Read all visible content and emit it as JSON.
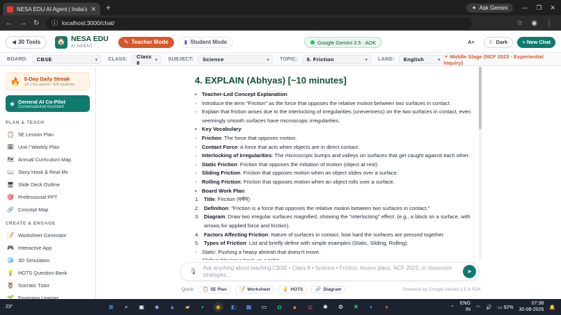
{
  "browser": {
    "tab_title": "NESA EDU AI Agent | India's Sm",
    "new_tab": "+",
    "url": "localhost:3000/chat/",
    "ask_gemini": "Ask Gemini",
    "window_controls": [
      "—",
      "❐",
      "✕"
    ]
  },
  "header": {
    "tools_label": "30 Tools",
    "brand_name": "NESA EDU",
    "brand_sub": "AI AGENT",
    "teacher_mode": "Teacher Mode",
    "student_mode": "Student Mode",
    "model_label": "Google Gemini 3.5 · ADK",
    "font_btn": "A+",
    "theme_btn": "Dark",
    "new_chat": "+ New Chat"
  },
  "filters": {
    "board_label": "BOARD:",
    "board_value": "CBSE",
    "class_label": "CLASS:",
    "class_value": "Class 8",
    "subject_label": "SUBJECT:",
    "subject_value": "Science",
    "topic_label": "TOPIC:",
    "topic_value": "9. Friction",
    "lang_label": "LANG:",
    "lang_value": "English",
    "stage": "Middle Stage (NCF 2023 · Experiential Inquiry)"
  },
  "sidebar": {
    "streak_title": "5-Day Daily Streak",
    "streak_sub": "14.2 hrs saved • 420 students",
    "copilot_title": "General AI Co-Pilot",
    "copilot_sub": "Conversational Assistant",
    "section1": "PLAN & TEACH",
    "plan_items": [
      {
        "label": "5E Lesson Plan",
        "icon": "📋"
      },
      {
        "label": "Unit / Weekly Plan",
        "icon": "🗓"
      },
      {
        "label": "Annual Curriculum Map",
        "icon": "🗺"
      },
      {
        "label": "Story Hook & Real-life",
        "icon": "📖"
      },
      {
        "label": "Slide Deck Outline",
        "icon": "🖥"
      },
      {
        "label": "Professional PPT",
        "icon": "🎯"
      },
      {
        "label": "Concept Map",
        "icon": "🔗"
      }
    ],
    "section2": "CREATE & ENGAGE",
    "create_items": [
      {
        "label": "Worksheet Generator",
        "icon": "📝"
      },
      {
        "label": "Interactive App",
        "icon": "🎮"
      },
      {
        "label": "3D Simulation",
        "icon": "🧊"
      },
      {
        "label": "HOTS Question Bank",
        "icon": "💡"
      },
      {
        "label": "Socratic Tutor",
        "icon": "🦉"
      },
      {
        "label": "Emerging Learner",
        "icon": "🌱"
      }
    ]
  },
  "lesson": {
    "heading": "4. EXPLAIN (Abhyas) [~10 minutes]",
    "lines": [
      {
        "bullet": "•",
        "bold": "Teacher-Led Concept Explanation",
        "text": ":",
        "italic": ""
      },
      {
        "bullet": "◦",
        "bold": "",
        "text": "Introduce the term \"Friction\" as the force that opposes the relative motion between two surfaces in contact.",
        "italic": ""
      },
      {
        "bullet": "◦",
        "bold": "",
        "text": "Explain that friction arises due to the interlocking of irregularities (unevenness) on the two surfaces in contact, even seemingly smooth surfaces have microscopic irregularities.",
        "italic": ""
      },
      {
        "bullet": "•",
        "bold": "Key Vocabulary",
        "text": ":",
        "italic": ""
      },
      {
        "bullet": "◦",
        "bold": "Friction",
        "text": ": The force that opposes motion.",
        "italic": ""
      },
      {
        "bullet": "◦",
        "bold": "Contact Force",
        "text": ": A force that acts when objects are in direct contact.",
        "italic": ""
      },
      {
        "bullet": "◦",
        "bold": "Interlocking of Irregularities",
        "text": ": The microscopic bumps and valleys on surfaces that get caught against each other.",
        "italic": ""
      },
      {
        "bullet": "◦",
        "bold": "Static Friction",
        "text": ": Friction that opposes the initiation of motion (object at rest).",
        "italic": ""
      },
      {
        "bullet": "◦",
        "bold": "Sliding Friction",
        "text": ": Friction that opposes motion when an object slides over a surface.",
        "italic": ""
      },
      {
        "bullet": "◦",
        "bold": "Rolling Friction",
        "text": ": Friction that opposes motion when an object rolls over a surface.",
        "italic": ""
      },
      {
        "bullet": "•",
        "bold": "Board Work Plan",
        "text": ":",
        "italic": ""
      },
      {
        "bullet": "1.",
        "bold": "Title",
        "text": ": Friction (घर्षण)",
        "italic": ""
      },
      {
        "bullet": "2.",
        "bold": "Definition",
        "text": ": \"Friction is a force that opposes the relative motion between two surfaces in contact.\"",
        "italic": ""
      },
      {
        "bullet": "3.",
        "bold": "Diagram",
        "text": ": Draw two irregular surfaces magnified, showing the \"interlocking\" effect. (e.g., a block on a surface, with arrows for applied force and friction).",
        "italic": ""
      },
      {
        "bullet": "4.",
        "bold": "Factors Affecting Friction",
        "text": ": Nature of surfaces in contact, how hard the surfaces are pressed together.",
        "italic": ""
      },
      {
        "bullet": "5.",
        "bold": "Types of Friction",
        "text": ": List and briefly define with simple examples (Static, Sliding, Rolling).",
        "italic": ""
      },
      {
        "bullet": "◦",
        "bold": "",
        "text": ": Pushing a heavy almirah that doesn't move.",
        "italic": "Static"
      },
      {
        "bullet": "◦",
        "bold": "",
        "text": ": Moving a book on a table.",
        "italic": "Sliding"
      }
    ]
  },
  "composer": {
    "placeholder": "Ask anything about teaching CBSE • Class 8 • Science • Friction, lesson plans, NCF 2023, or classroom strategies...",
    "quick_label": "Quick:",
    "quick_buttons": [
      "5E Plan",
      "Worksheet",
      "HOTS",
      "Diagram"
    ],
    "powered": "Powered by Google Gemini 3.5 & ADK"
  },
  "taskbar": {
    "temp": "23°",
    "lang1": "ENG",
    "lang2": "IN",
    "battery": "92%",
    "time": "07:38",
    "date": "30-08-2026"
  }
}
